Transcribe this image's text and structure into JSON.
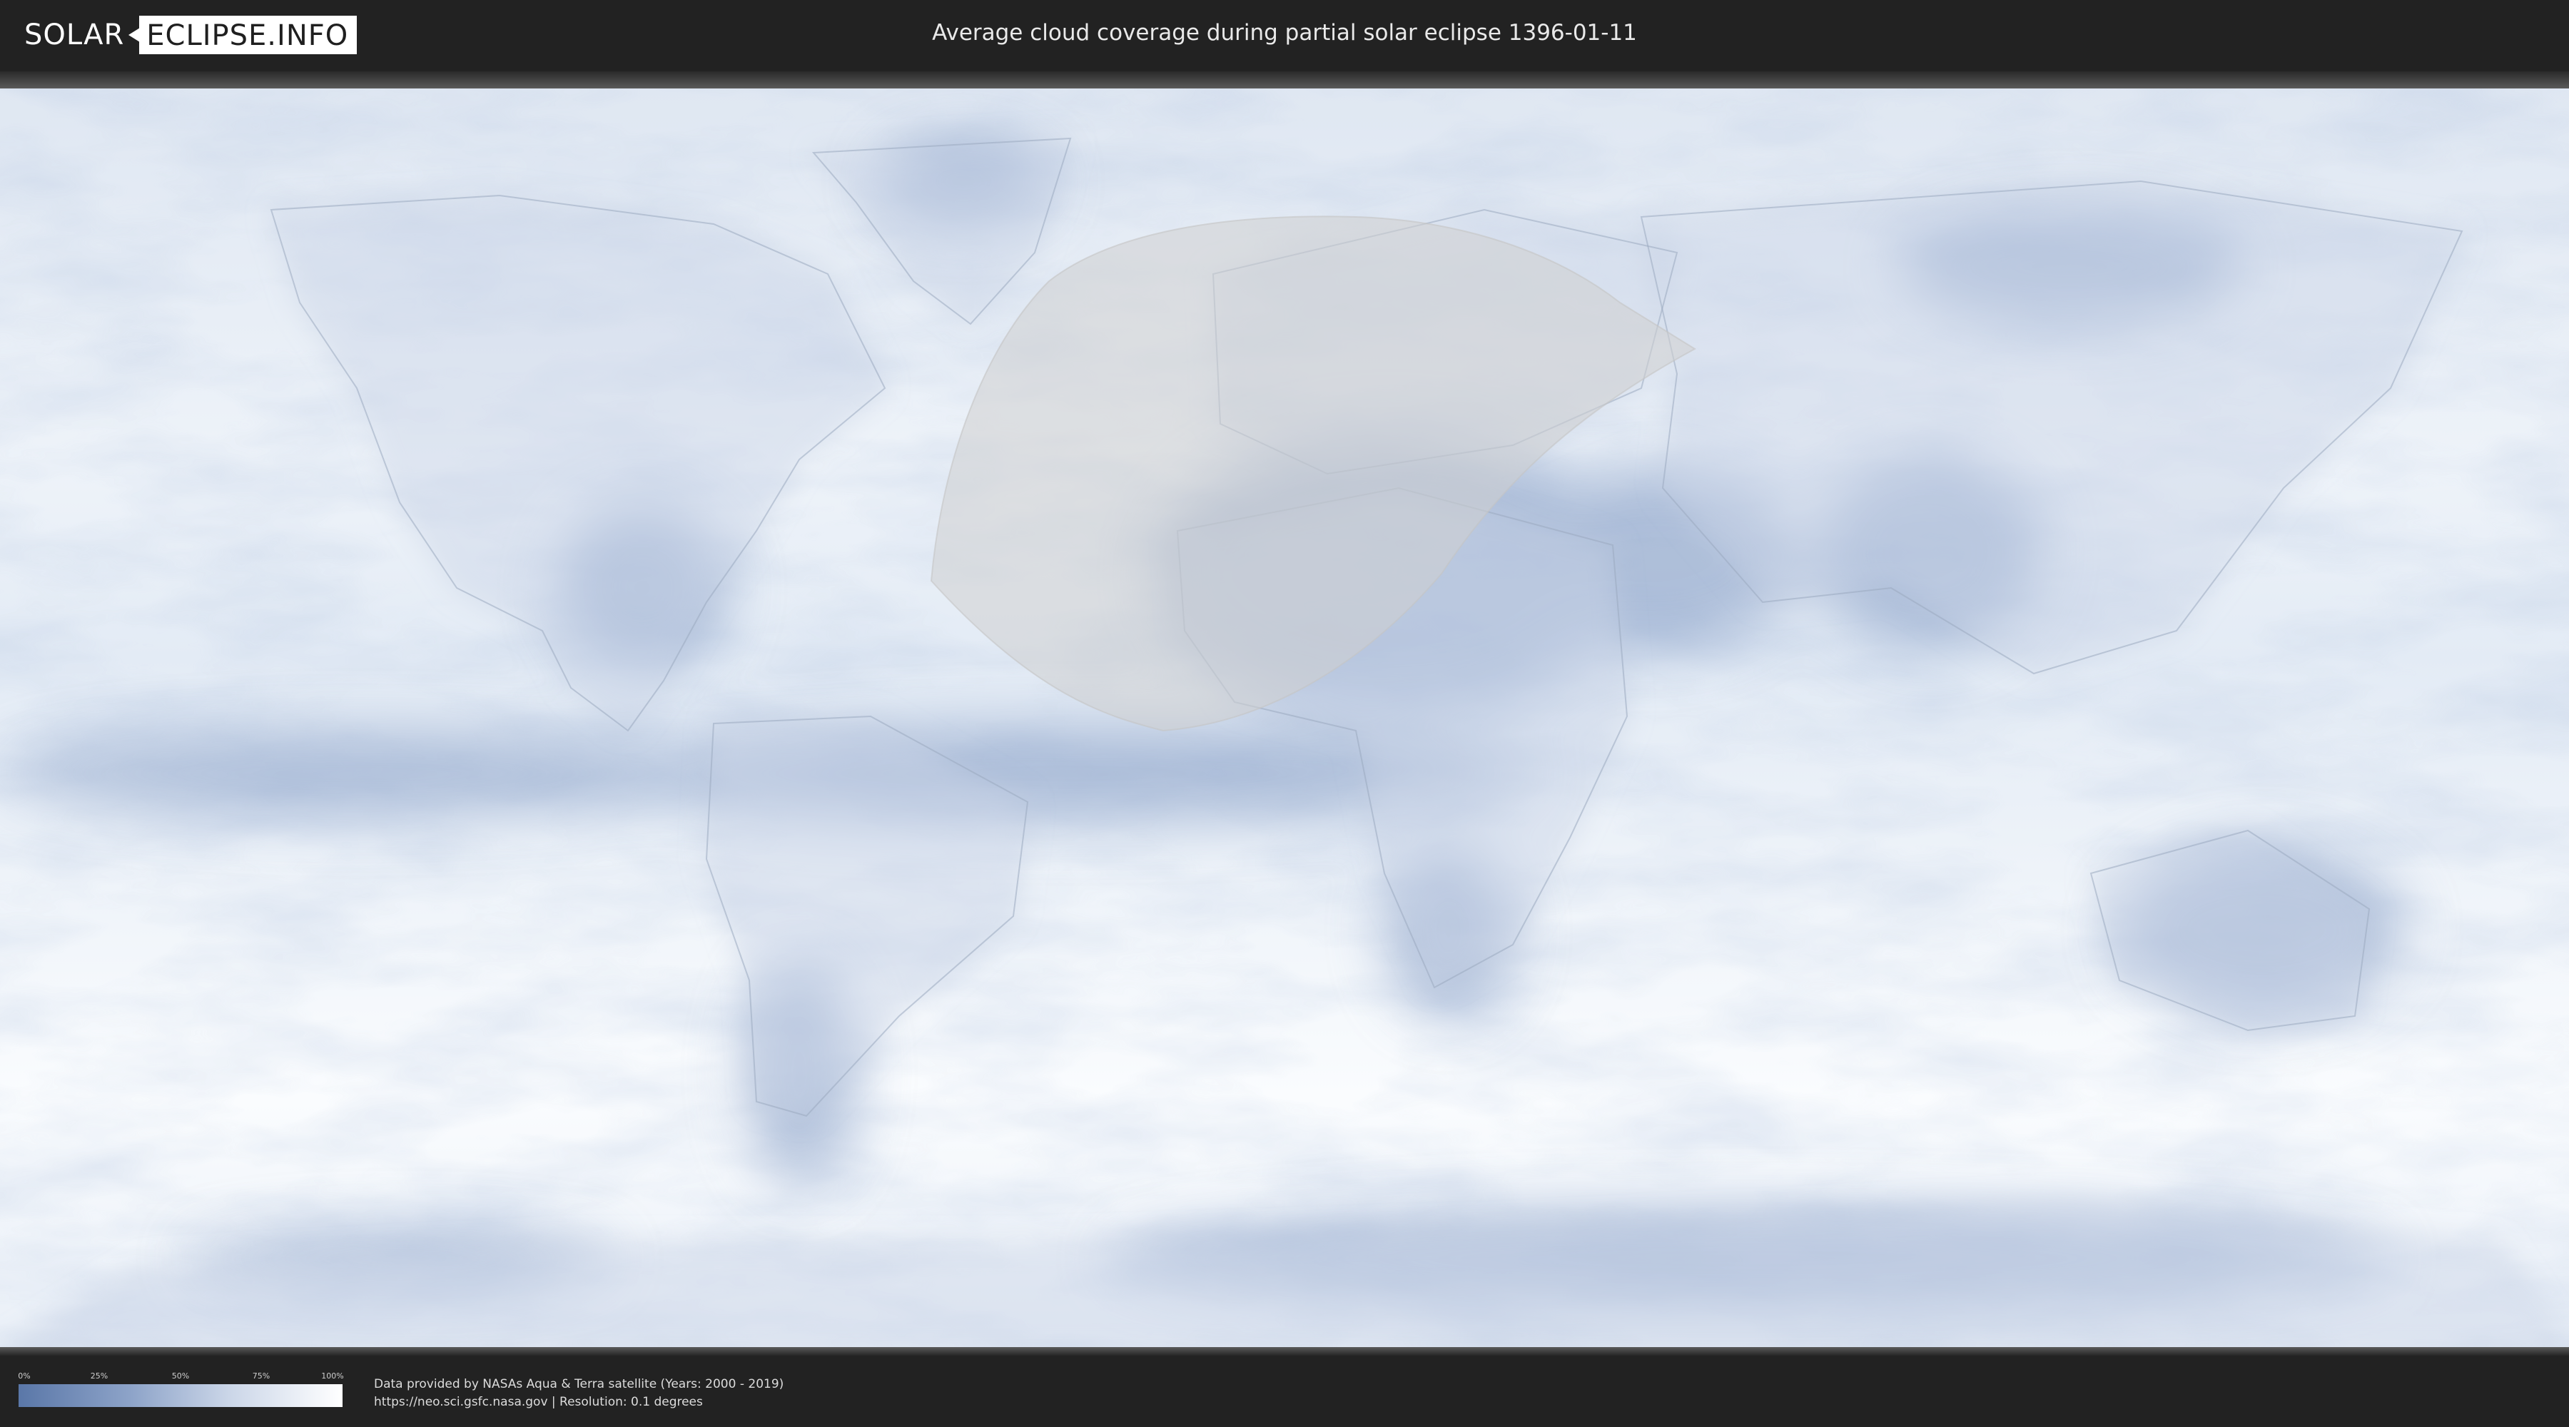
{
  "header": {
    "logo_part1": "SOLAR",
    "logo_part2": "ECLIPSE.INFO",
    "title": "Average cloud coverage during partial solar eclipse 1396-01-11"
  },
  "map": {
    "colors": {
      "ocean_clear": "#f2f6fb",
      "cloud_low": "#7f98c2",
      "land_outline": "#9fb0c8",
      "eclipse_zone": "#cfcfcf"
    }
  },
  "legend": {
    "ticks": [
      "0%",
      "25%",
      "50%",
      "75%",
      "100%"
    ],
    "gradient_start": "#5a77a8",
    "gradient_end": "#ffffff"
  },
  "footer": {
    "credit_line1": "Data provided by NASAs Aqua & Terra satellite (Years: 2000 - 2019)",
    "credit_line2": "https://neo.sci.gsfc.nasa.gov | Resolution: 0.1 degrees"
  }
}
